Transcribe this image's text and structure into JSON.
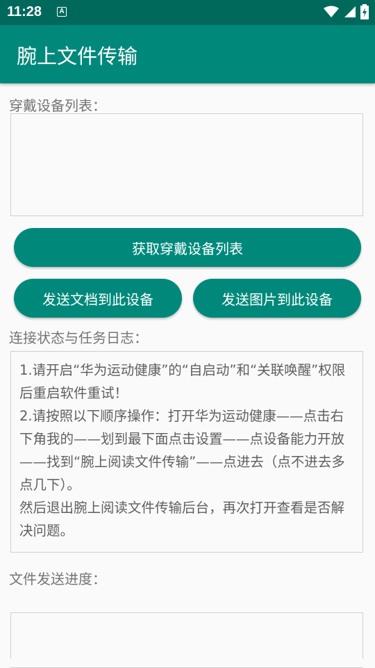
{
  "status_bar": {
    "time": "11:28",
    "notification_icon": "A",
    "icons": [
      "wifi-icon",
      "cell-signal-icon",
      "battery-icon"
    ]
  },
  "app": {
    "title": "腕上文件传输",
    "colors": {
      "primary": "#00897b",
      "primary_dark": "#00695c"
    }
  },
  "devices": {
    "label": "穿戴设备列表：",
    "get_button": "获取穿戴设备列表",
    "send_doc_button": "发送文档到此设备",
    "send_image_button": "发送图片到此设备"
  },
  "log": {
    "label": "连接状态与任务日志：",
    "lines": [
      "1.请开启“华为运动健康”的“自启动”和“关联唤醒”权限后重启软件重试！",
      "2.请按照以下顺序操作：打开华为运动健康——点击右下角我的——划到最下面点击设置——点设备能力开放——找到“腕上阅读文件传输”——点进去（点不进去多点几下）。",
      "然后退出腕上阅读文件传输后台，再次打开查看是否解决问题。"
    ]
  },
  "progress": {
    "label": "文件发送进度："
  }
}
